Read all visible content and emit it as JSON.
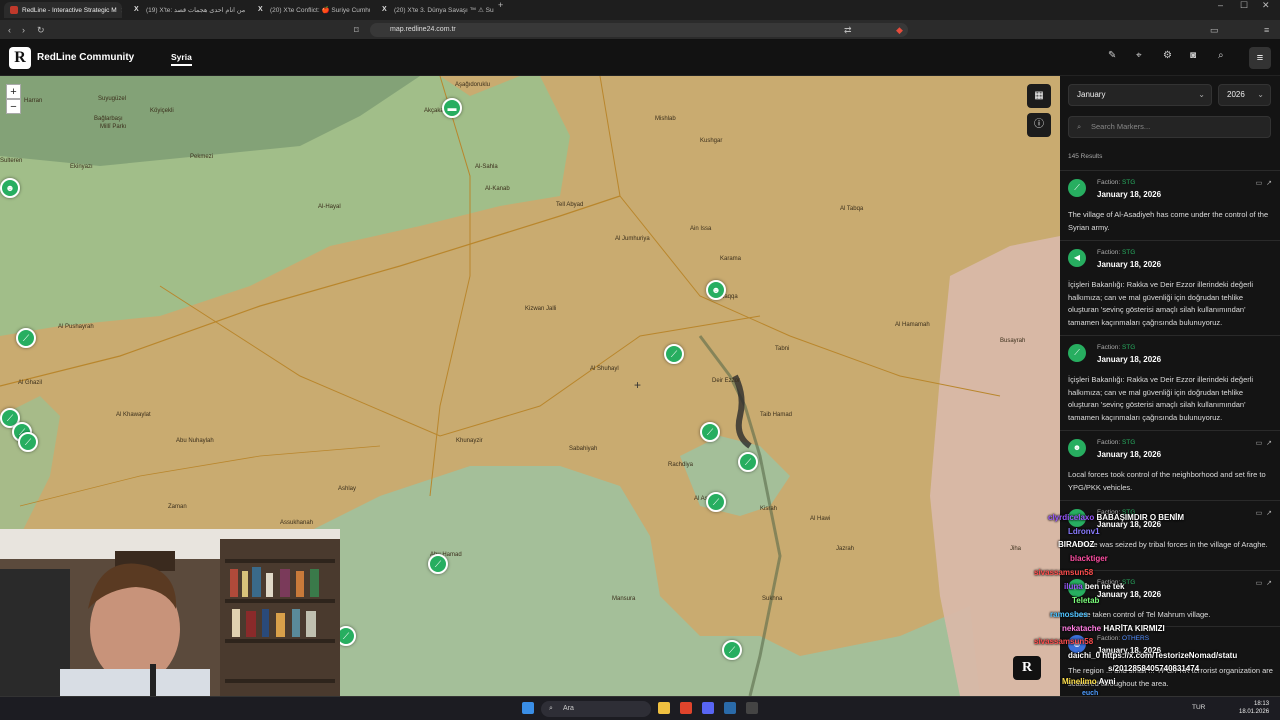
{
  "browser": {
    "tabs": [
      {
        "title": "RedLine - Interactive Strategic M",
        "active": true
      },
      {
        "title": "(19) X'te: ةيب من انام احدى هجمات قصد",
        "active": false
      },
      {
        "title": "(20) X'te Conflict: 🍎 Suriye Cumhu",
        "active": false
      },
      {
        "title": "(20) X'te 3. Dünya Savaşı ™ ⚠ Suriye",
        "active": false
      }
    ],
    "url": "map.redline24.com.tr"
  },
  "app": {
    "logo_letter": "R",
    "brand": "RedLine Community",
    "nav_active": "Syria",
    "header_icons": [
      "pencil-icon",
      "location-pin-icon",
      "gear-icon",
      "camera-icon",
      "search-icon",
      "menu-icon"
    ]
  },
  "map": {
    "zoom_in": "+",
    "zoom_out": "−",
    "places": [
      "Aşağıdoruklu",
      "Harran",
      "Suyugüzel",
      "Köyiçekli",
      "Bağlarbaşı",
      "Millî Parkı",
      "Pekmezi",
      "Ekinyazı",
      "Sulteren",
      "Akçakale",
      "Tell Abyad",
      "Al-Sahla",
      "Al-Kanab",
      "Al-Hayal",
      "Kushgar",
      "Mishlab",
      "Ain Issa",
      "Al Pushayrah",
      "Al Ghazil",
      "Al Khawaylat",
      "Abu Nuhaylah",
      "Kizwan Jalli",
      "Khunayzir",
      "Sabahiyah",
      "Ashlay",
      "Zaman",
      "Assukhanah",
      "Abu Hamad",
      "Raqqa",
      "Al Jumhuriya",
      "Karama",
      "Tabni",
      "Al Hamamah",
      "Taib Hamad",
      "Al Hawi",
      "Kisrah",
      "Mansura",
      "Al Tabqa",
      "Al Shuhayl",
      "Jazrah",
      "Rachdiya",
      "Jiha",
      "Al Asadiyah",
      "Deir Ezzor",
      "Sukhna",
      "Busayrah"
    ]
  },
  "sidebar": {
    "month": "January",
    "year": "2026",
    "search_placeholder": "Search Markers...",
    "results": "145 Results",
    "cards": [
      {
        "faction_label": "Faction:",
        "faction": "STG",
        "date": "January 18, 2026",
        "text": "The village of Al-Asadiyeh has come under the control of the Syrian army."
      },
      {
        "faction_label": "Faction:",
        "faction": "STG",
        "date": "January 18, 2026",
        "text": "İçişleri Bakanlığı: Rakka ve Deir Ezzor illerindeki değerli halkımıza; can ve mal güvenliği için doğrudan tehlike oluşturan 'sevinç gösterisi amaçlı silah kullanımından' tamamen kaçınmaları çağrısında bulunuyoruz."
      },
      {
        "faction_label": "Faction:",
        "faction": "STG",
        "date": "January 18, 2026",
        "text": "İçişleri Bakanlığı: Rakka ve Deir Ezzor illerindeki değerli halkımıza; can ve mal güvenliği için doğrudan tehlike oluşturan 'sevinç gösterisi amaçlı silah kullanımından' tamamen kaçınmaları çağrısında bulunuyoruz."
      },
      {
        "faction_label": "Faction:",
        "faction": "STG",
        "date": "January 18, 2026",
        "text": "Local forces took control of the neighborhood and set fire to YPG/PKK vehicles."
      },
      {
        "faction_label": "Faction:",
        "faction": "STG",
        "date": "January 18, 2026",
        "text": "...vehicle was seized by tribal forces in the village of Araghe."
      },
      {
        "faction_label": "Faction:",
        "faction": "STG",
        "date": "January 18, 2026",
        "text": "...have taken control of Tel Mahrum village."
      },
      {
        "faction_label": "Faction:",
        "faction": "OTHERS",
        "date": "January 18, 2026",
        "text": "The region ... and small ... YPG/PKK terrorist organization are scattered throughout the area."
      }
    ]
  },
  "chat": [
    {
      "user": "clyrdicelaxo",
      "msg": "BABAŞIMDIR O BENİM",
      "color": "#9b59ff"
    },
    {
      "user": "Ldronv1",
      "msg": "",
      "color": "#8a7bff"
    },
    {
      "user": "BIRADOZ",
      "msg": "",
      "color": "#ffffff"
    },
    {
      "user": "blacktiger",
      "msg": "",
      "color": "#ff4fa3"
    },
    {
      "user": "sivassamsun58",
      "msg": "",
      "color": "#ff4f4f"
    },
    {
      "user": "iluna",
      "msg": "ben ne tek",
      "color": "#9b59ff"
    },
    {
      "user": "Teletab",
      "msg": "",
      "color": "#7cff7c"
    },
    {
      "user": "ramosbes",
      "msg": "",
      "color": "#4fc3ff"
    },
    {
      "user": "nekatache",
      "msg": "HARİTA KIRMIZI",
      "color": "#ff7ce0"
    },
    {
      "user": "sivassamsun58",
      "msg": "",
      "color": "#ff4f4f"
    },
    {
      "user": "daichi_0",
      "msg": "https://x.com/TestorizeNomad/statu",
      "color": "#ffffff"
    },
    {
      "user": "",
      "msg": "s/2012858405740831474",
      "color": "#ffffff"
    },
    {
      "user": "Minelimo",
      "msg": "Ayni",
      "color": "#ffe14f"
    },
    {
      "user": "euch",
      "msg": "",
      "color": "#4f9dff"
    }
  ],
  "taskbar": {
    "search": "Ara",
    "lang": "TUR",
    "time": "18:13",
    "date": "18.01.2026"
  },
  "colors": {
    "accent": "#27ae60",
    "control_green": "#8fd39a",
    "sand": "#c7a96e"
  }
}
